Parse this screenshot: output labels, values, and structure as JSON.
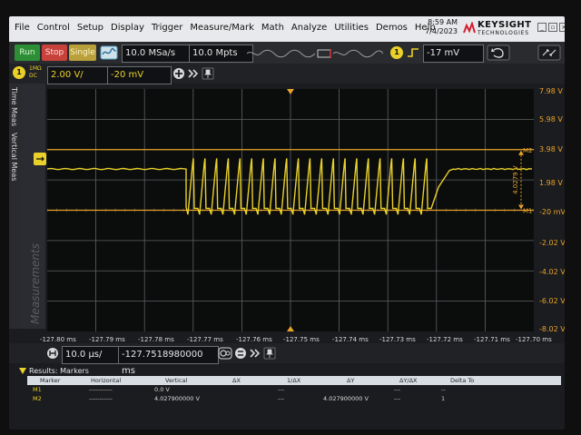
{
  "menubar": {
    "items": [
      "File",
      "Control",
      "Setup",
      "Display",
      "Trigger",
      "Measure/Mark",
      "Math",
      "Analyze",
      "Utilities",
      "Demos",
      "Help"
    ],
    "time": "8:59 AM",
    "date": "7/4/2023",
    "logo": "KEYSIGHT",
    "logo_sub": "TECHNOLOGIES"
  },
  "toolbar": {
    "run_label": "Run",
    "stop_label": "Stop",
    "single_label": "Single",
    "sample_rate": "10.0 MSa/s",
    "memory_depth": "10.0 Mpts",
    "trigger_level": "-17 mV",
    "trigger_channel": "1"
  },
  "channel": {
    "number": "1",
    "coupling_top": "1MΩ",
    "coupling_bottom": "DC",
    "scale": "2.00 V/",
    "offset": "-20 mV"
  },
  "sidetabs": {
    "time_meas": "Time Meas",
    "vertical_meas": "Vertical Meas",
    "measurements": "Measurements"
  },
  "axis": {
    "right_labels": [
      "7.98 V",
      "5.98 V",
      "3.98 V",
      "1.98 V",
      "-20 mV",
      "-2.02 V",
      "-4.02 V",
      "-6.02 V",
      "-8.02 V"
    ],
    "x_labels": [
      "-127.80 ms",
      "-127.79 ms",
      "-127.78 ms",
      "-127.77 ms",
      "-127.76 ms",
      "-127.75 ms",
      "-127.74 ms",
      "-127.73 ms",
      "-127.72 ms",
      "-127.71 ms",
      "-127.70 ms"
    ],
    "marker_m1": "M1",
    "marker_m2": "M2",
    "delta_label": "4.0279 V"
  },
  "timebase": {
    "scale": "10.0 µs/",
    "position": "-127.7518980000 ms"
  },
  "results": {
    "title": "Results: Markers",
    "headers": [
      "Marker",
      "Horizontal",
      "Vertical",
      "ΔX",
      "1/ΔX",
      "ΔY",
      "ΔY/ΔX",
      "Delta To"
    ],
    "rows": [
      [
        "M1",
        "-----------",
        "0.0 V",
        "---",
        "---",
        "",
        "---",
        "--"
      ],
      [
        "M2",
        "-----------",
        "4.027900000 V",
        "---",
        "---",
        "4.027900000 V",
        "---",
        "1"
      ]
    ]
  },
  "colors": {
    "trace": "#e9d12a",
    "marker": "#e8a22a",
    "grid": "#5e6165"
  }
}
